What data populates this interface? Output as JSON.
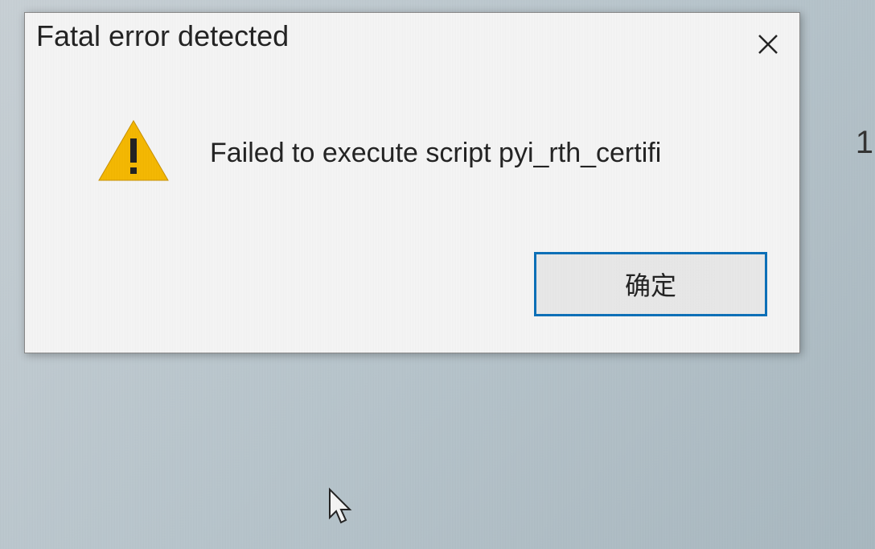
{
  "dialog": {
    "title": "Fatal error detected",
    "message": "Failed to execute script pyi_rth_certifi",
    "ok_label": "确定"
  },
  "icons": {
    "close": "close-x",
    "warning": "warning-triangle"
  },
  "side_text": "1"
}
